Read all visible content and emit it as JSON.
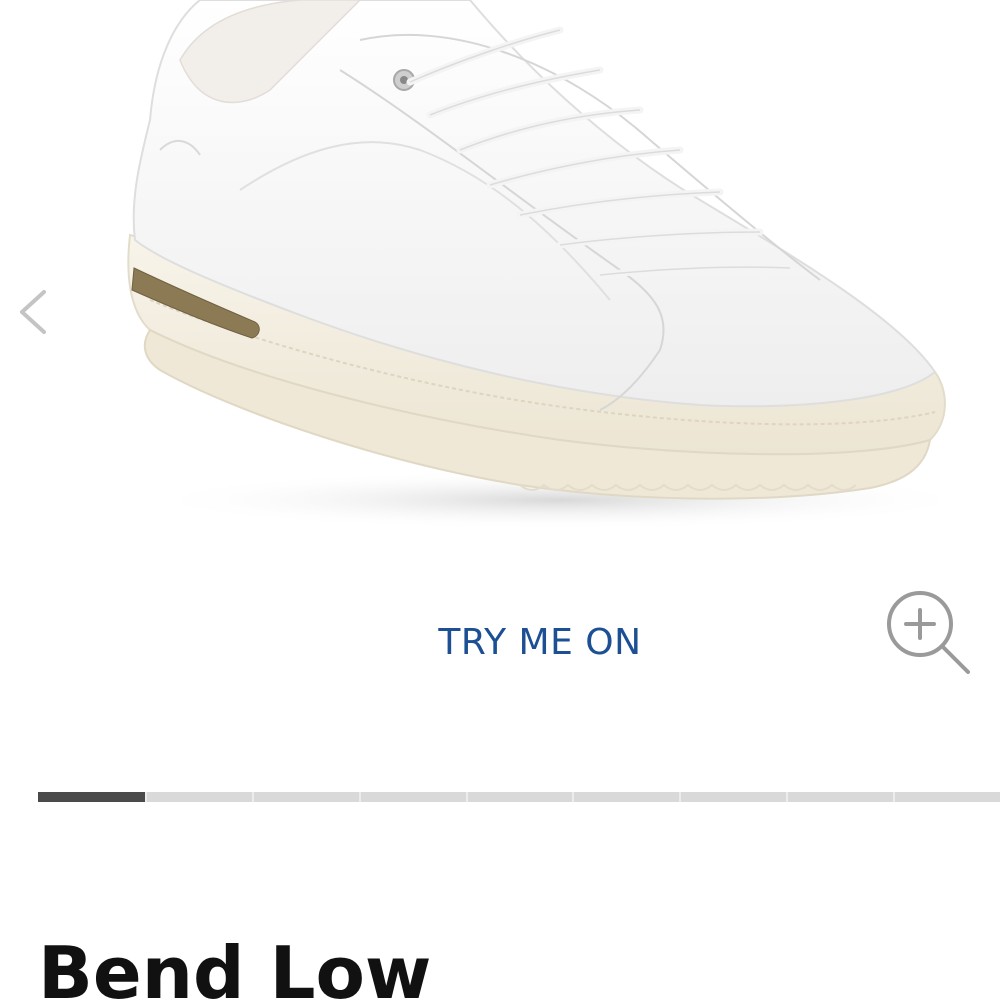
{
  "gallery": {
    "image_subject": "white leather low-top sneaker",
    "prev_icon": "chevron-left-icon",
    "zoom_icon": "zoom-in-icon",
    "progress": {
      "current_slide": 1,
      "total_slides": 9
    }
  },
  "actions": {
    "try_on_label": "TRY ME ON"
  },
  "product": {
    "title": "Bend Low"
  },
  "colors": {
    "accent_blue": "#1c4f93",
    "progress_active": "#4a4a4a",
    "progress_track": "#d9d9d9",
    "cork_accent": "#8b7a54"
  }
}
